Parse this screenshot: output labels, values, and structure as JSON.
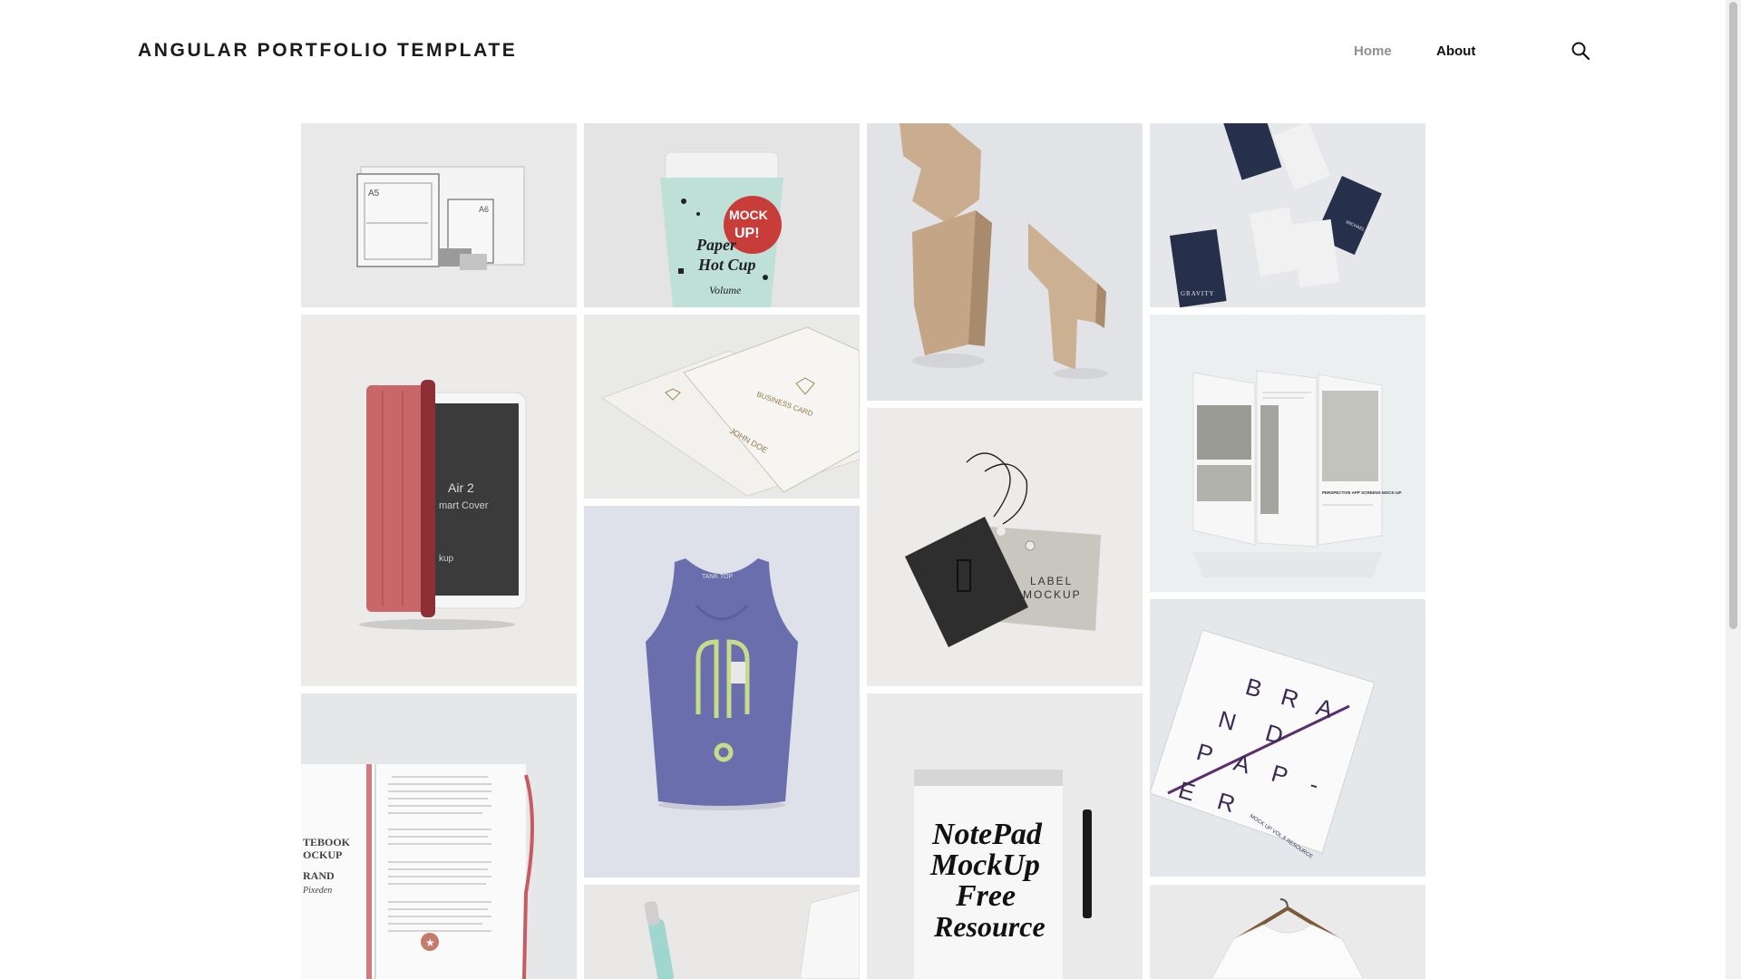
{
  "header": {
    "title": "ANGULAR PORTFOLIO TEMPLATE",
    "nav": {
      "home": "Home",
      "about": "About"
    },
    "search_icon": "search-icon"
  },
  "tiles": {
    "papers": {
      "a5": "A5",
      "a6": "A6"
    },
    "cup": {
      "mock": "MOCK",
      "up": "UP!",
      "line1": "Paper",
      "line2": "Hot Cup",
      "volume": "Volume"
    },
    "label": {
      "line1": "LABEL",
      "line2": "MOCKUP"
    },
    "ipad": {
      "line1": "Air 2",
      "line2": "mart Cover",
      "line3": "kup"
    },
    "card": {
      "title": "BUSINESS CARD",
      "name": "JOHN DOE"
    },
    "gravity": {
      "name": "GRAVITY",
      "person": "MICHAEL SMITH"
    },
    "app": {
      "heading": "PERSPECTIVE APP SCREENS MOCK-UP"
    },
    "brand": {
      "l1": "B R A",
      "l2": "N D",
      "l3": "P A P -",
      "l4": "E R",
      "tag": "MOCK UP VOL.8 RESOURCE"
    },
    "notebook": {
      "l1": "TEBOOK",
      "l2": "OCKUP",
      "l3": "RAND",
      "l4": "Pixeden"
    },
    "notepad": {
      "l1": "NotePad",
      "l2": "MockUp",
      "l3": "Free",
      "l4": "Resource"
    },
    "tank": {
      "tag": "TANK TOP"
    }
  },
  "colors": {
    "tile_bg": "#e6e6e6",
    "nav_inactive": "#8f8f8f",
    "ipad_cover": "#c9666a",
    "tank_top": "#6a6eac",
    "card_dark": "#27304a"
  }
}
